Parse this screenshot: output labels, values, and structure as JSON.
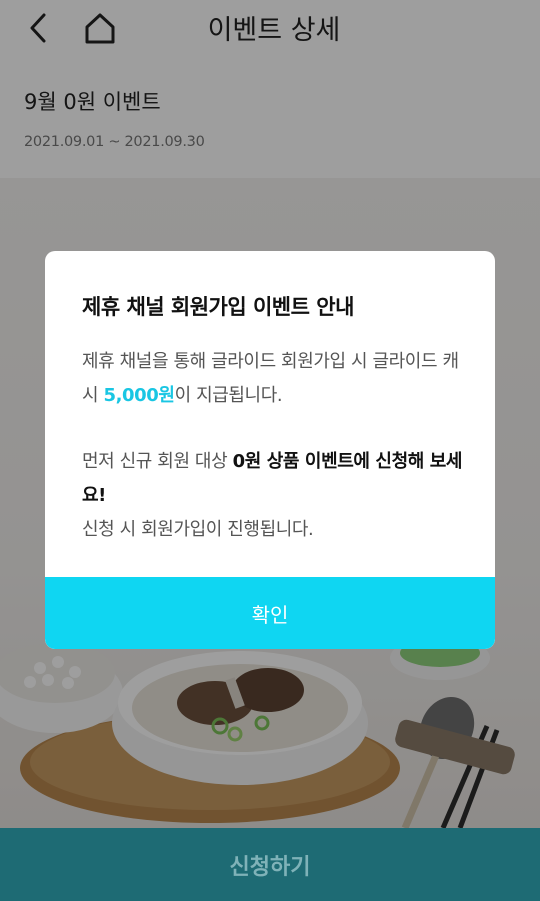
{
  "header": {
    "title": "이벤트 상세",
    "back_icon": "chevron-left-icon",
    "home_icon": "home-icon"
  },
  "event": {
    "title": "9월 0원 이벤트",
    "period": "2021.09.01 ~ 2021.09.30"
  },
  "modal": {
    "title": "제휴 채널 회원가입 이벤트 안내",
    "para1_prefix": "제휴 채널을 통해 글라이드 회원가입 시 글라이드 캐시 ",
    "para1_highlight": "5,000원",
    "para1_suffix": "이 지급됩니다.",
    "para2_prefix": "먼저 신규 회원 대상 ",
    "para2_strong": "0원 상품 이벤트에 신청해 보세요!",
    "para3": "신청 시 회원가입이 진행됩니다.",
    "confirm_label": "확인"
  },
  "apply_button": {
    "label": "신청하기"
  },
  "colors": {
    "accent": "#0fd6f2",
    "highlight": "#19c6e3",
    "apply_bar": "#2aa6b4"
  }
}
